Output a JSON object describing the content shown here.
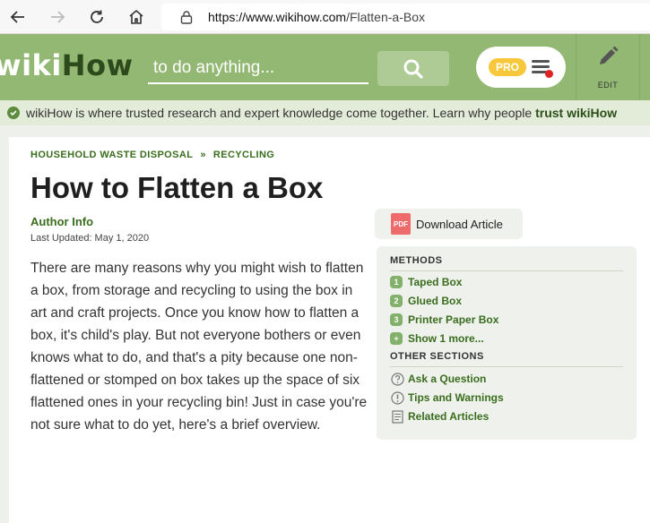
{
  "browser": {
    "url_host": "https://www.wikihow.com",
    "url_path": "/Flatten-a-Box"
  },
  "header": {
    "logo_wiki": "wiki",
    "logo_how": "How",
    "search_placeholder": "to do anything...",
    "pro_label": "PRO",
    "edit_label": "EDIT"
  },
  "trust": {
    "text": "wikiHow is where trusted research and expert knowledge come together. Learn why people ",
    "link": "trust wikiHow"
  },
  "article": {
    "breadcrumb": [
      "HOUSEHOLD WASTE DISPOSAL",
      "»",
      "RECYCLING"
    ],
    "title": "How to Flatten a Box",
    "author_label": "Author Info",
    "updated": "Last Updated: May 1, 2020",
    "intro": "There are many reasons why you might wish to flatten a box, from storage and recycling to using the box in art and craft projects. Once you know how to flatten a box, it's child's play. But not everyone bothers or even knows what to do, and that's a pity because one non-flattened or stomped on box takes up the space of six flattened ones in your recycling bin! Just in case you're not sure what to do yet, here's a brief overview."
  },
  "download": {
    "icon_text": "PDF",
    "label": "Download Article"
  },
  "toc": {
    "methods_heading": "METHODS",
    "methods": [
      {
        "num": "1",
        "label": "Taped Box"
      },
      {
        "num": "2",
        "label": "Glued Box"
      },
      {
        "num": "3",
        "label": "Printer Paper Box"
      }
    ],
    "show_more": "Show 1 more...",
    "show_more_icon": "+",
    "other_heading": "OTHER SECTIONS",
    "other": [
      {
        "icon": "question-icon",
        "label": "Ask a Question"
      },
      {
        "icon": "warning-icon",
        "label": "Tips and Warnings"
      },
      {
        "icon": "document-icon",
        "label": "Related Articles"
      }
    ]
  },
  "colors": {
    "header_green": "#93b874",
    "link_green": "#3a6d1e",
    "pro_yellow": "#f7c83c",
    "notification_red": "#e02323"
  }
}
